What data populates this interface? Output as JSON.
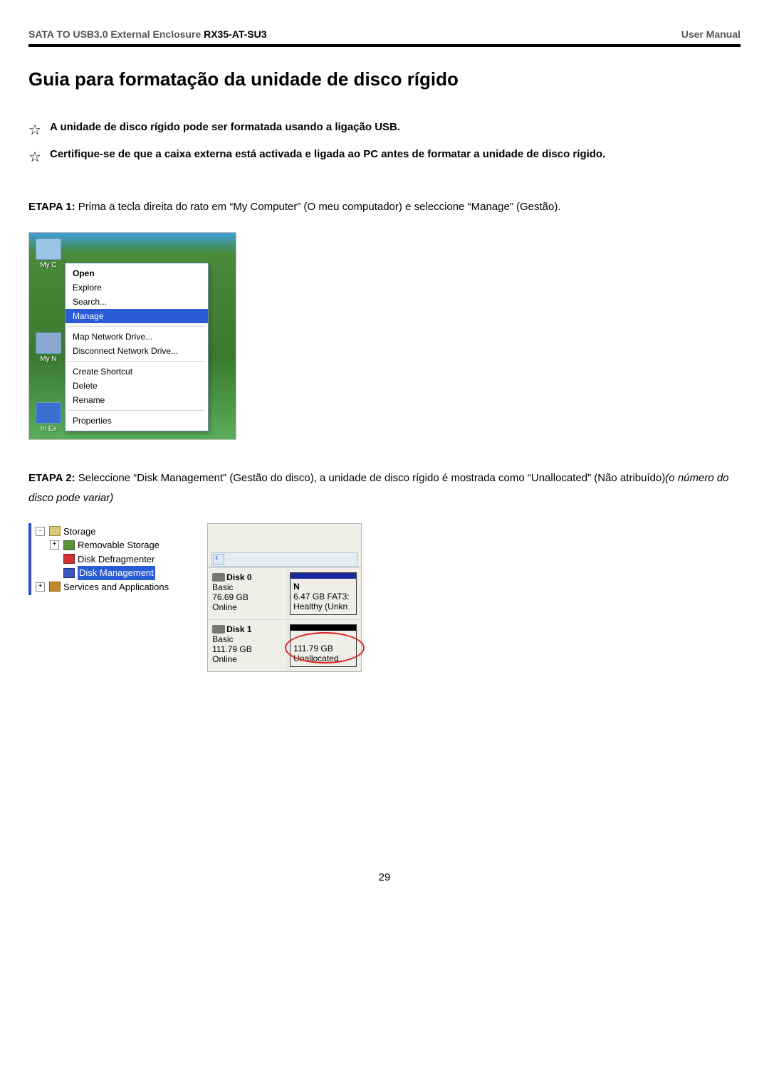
{
  "header": {
    "product": "SATA TO USB3.0 External Enclosure",
    "model": "RX35-AT-SU3",
    "right": "User Manual"
  },
  "title": "Guia para formatação da unidade de disco rígido",
  "notes": {
    "n1": "A unidade de disco rígido pode ser formatada usando a ligação USB.",
    "n2": "Certifique-se de que a caixa externa está activada e ligada ao PC antes de formatar a unidade de disco rígido."
  },
  "step1": {
    "label": "ETAPA 1:",
    "text": " Prima a tecla direita do rato em “My Computer” (O meu computador) e seleccione “Manage” (Gestão)."
  },
  "fig1": {
    "icon_labels": {
      "myc": "My C",
      "myn": "My N",
      "ie": "In Ex"
    },
    "menu": {
      "open": "Open",
      "explore": "Explore",
      "search": "Search...",
      "manage": "Manage",
      "mapnet": "Map Network Drive...",
      "discnet": "Disconnect Network Drive...",
      "shortcut": "Create Shortcut",
      "delete": "Delete",
      "rename": "Rename",
      "props": "Properties"
    }
  },
  "step2": {
    "label": "ETAPA 2:",
    "text": " Seleccione “Disk Management” (Gestão do disco), a unidade de disco rígido é mostrada como “Unallocated” (Não atribuído)",
    "italic": "(o número do disco pode variar)"
  },
  "fig2": {
    "tree": {
      "storage": "Storage",
      "removable": "Removable Storage",
      "defrag": "Disk Defragmenter",
      "diskmgmt": "Disk Management",
      "services": "Services and Applications"
    },
    "disks": {
      "d0": {
        "name": "Disk 0",
        "type": "Basic",
        "size": "76.69 GB",
        "status": "Online",
        "part_label": "N",
        "part_size": "6.47 GB FAT3:",
        "part_state": "Healthy (Unkn"
      },
      "d1": {
        "name": "Disk 1",
        "type": "Basic",
        "size": "111.79 GB",
        "status": "Online",
        "part_size": "111.79 GB",
        "part_state": "Unallocated"
      }
    }
  },
  "page_number": "29"
}
